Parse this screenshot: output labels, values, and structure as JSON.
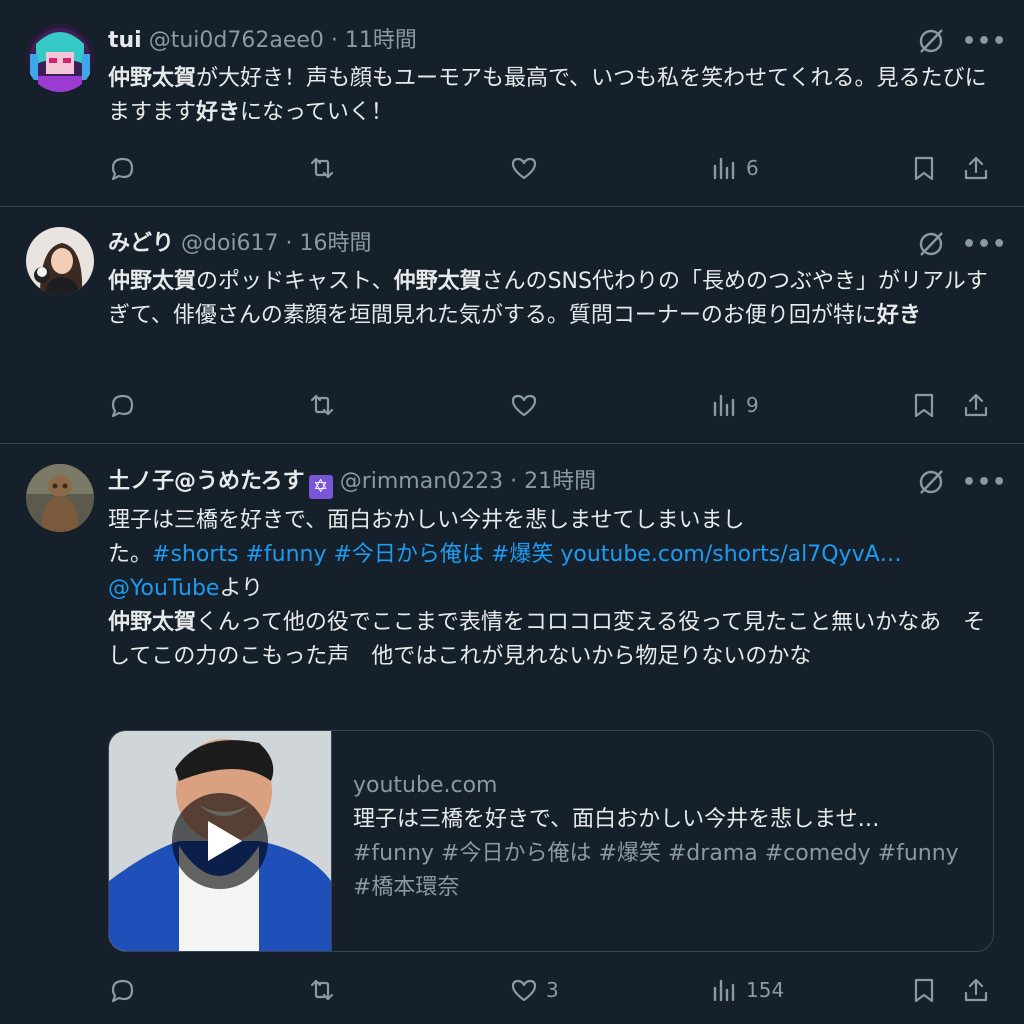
{
  "tweets": [
    {
      "name": "tui",
      "handle": "@tui0d762aee0",
      "sep": "·",
      "time": "11時間",
      "body": [
        {
          "t": "仲野太賀",
          "b": true
        },
        {
          "t": "が大好き！声も顔もユーモアも最高で、いつも私を笑わせてくれる。見るたびにますます"
        },
        {
          "t": "好き",
          "b": true
        },
        {
          "t": "になっていく！"
        }
      ],
      "actions": {
        "reply": "",
        "retweet": "",
        "like": "",
        "views": "6"
      }
    },
    {
      "name": "みどり",
      "handle": "@doi617",
      "sep": "·",
      "time": "16時間",
      "body": [
        {
          "t": "仲野太賀",
          "b": true
        },
        {
          "t": "のポッドキャスト、"
        },
        {
          "t": "仲野太賀",
          "b": true
        },
        {
          "t": "さんのSNS代わりの「長めのつぶやき」がリアルすぎて、俳優さんの素顔を垣間見れた気がする。質問コーナーのお便り回が特に"
        },
        {
          "t": "好き",
          "b": true
        }
      ],
      "actions": {
        "reply": "",
        "retweet": "",
        "like": "",
        "views": "9"
      }
    },
    {
      "name": "土ノ子@うめたろす",
      "badge": "✡",
      "handle": "@rimman0223",
      "sep": "·",
      "time": "21時間",
      "body_lines": [
        "理子は三橋を好きで、面白おかしい今井を悲しませてしまいまし",
        "た。",
        "#shorts",
        "#funny",
        "#今日から俺は",
        "#爆笑",
        "youtube.com/shorts/al7QyvA…",
        "@YouTube",
        "より",
        "仲野太賀",
        "くんって他の役でここまで表情をコロコロ変える役って見たこと無いかなあ　そしてこの力のこもった声　他ではこれが見れないから物足りないのかな"
      ],
      "card": {
        "domain": "youtube.com",
        "title": "理子は三橋を好きで、面白おかしい今井を悲しませ…",
        "desc": "#funny #今日から俺は #爆笑 #drama #comedy #funny #橋本環奈"
      },
      "actions": {
        "reply": "",
        "retweet": "",
        "like": "3",
        "views": "154"
      }
    }
  ],
  "icons": {
    "reply": "reply-icon",
    "retweet": "retweet-icon",
    "like": "heart-icon",
    "views": "views-icon",
    "bookmark": "bookmark-icon",
    "share": "share-icon",
    "grok": "grok-icon",
    "more": "more-icon"
  },
  "colors": {
    "background": "#15202b",
    "text": "#e7e9ea",
    "muted": "#8b98a5",
    "link": "#1d9bf0",
    "divider": "#38444d"
  }
}
